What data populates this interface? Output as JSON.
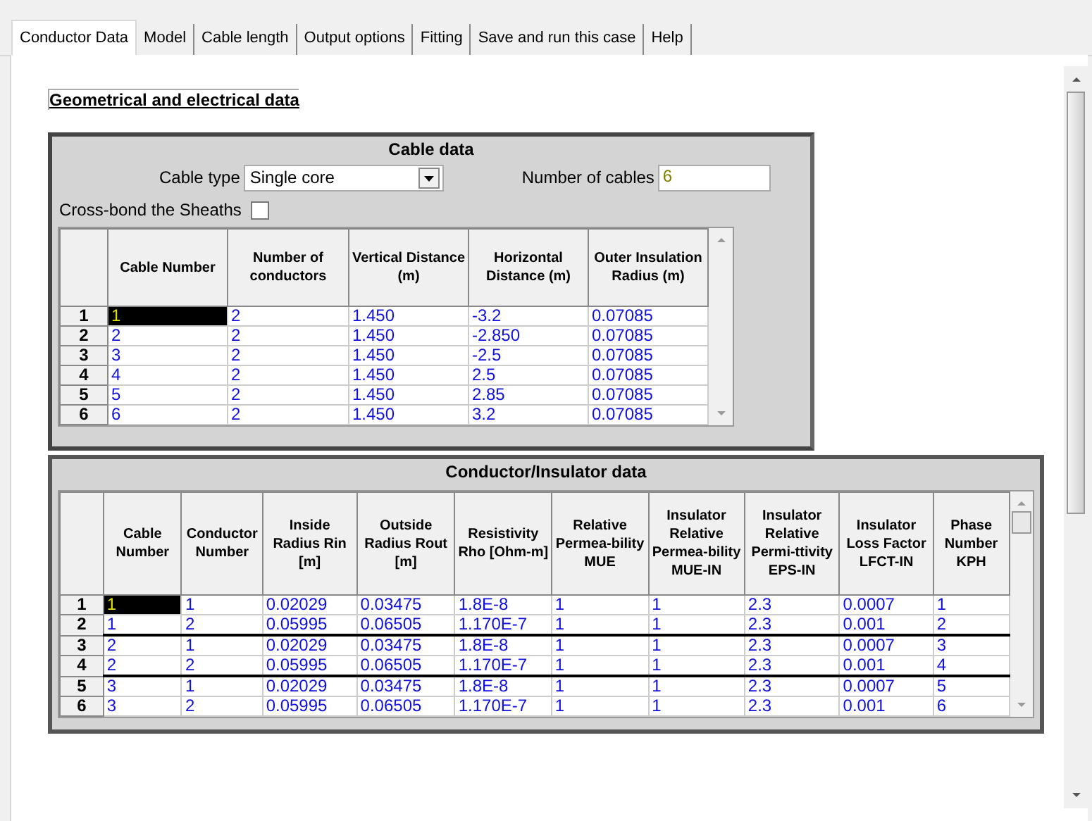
{
  "tabs": [
    {
      "label": "Conductor Data",
      "selected": true
    },
    {
      "label": "Model",
      "selected": false
    },
    {
      "label": "Cable length",
      "selected": false
    },
    {
      "label": "Output options",
      "selected": false
    },
    {
      "label": "Fitting",
      "selected": false
    },
    {
      "label": "Save and run this case",
      "selected": false
    },
    {
      "label": "Help",
      "selected": false
    }
  ],
  "heading": "Geometrical and electrical data",
  "cable_data": {
    "title": "Cable data",
    "cable_type_label": "Cable type",
    "cable_type": "Single core",
    "num_cables_label": "Number of cables",
    "num_cables": "6",
    "cross_bond_label": "Cross-bond the Sheaths",
    "cross_bond": false,
    "columns": [
      "Cable Number",
      "Number of conductors",
      "Vertical Distance (m)",
      "Horizontal Distance (m)",
      "Outer Insulation Radius (m)"
    ],
    "rows": [
      {
        "header": "1",
        "selected": true,
        "cells": [
          "1",
          "2",
          "1.450",
          "-3.2",
          "0.07085"
        ]
      },
      {
        "header": "2",
        "selected": false,
        "cells": [
          "2",
          "2",
          "1.450",
          "-2.850",
          "0.07085"
        ]
      },
      {
        "header": "3",
        "selected": false,
        "cells": [
          "3",
          "2",
          "1.450",
          "-2.5",
          "0.07085"
        ]
      },
      {
        "header": "4",
        "selected": false,
        "cells": [
          "4",
          "2",
          "1.450",
          "2.5",
          "0.07085"
        ]
      },
      {
        "header": "5",
        "selected": false,
        "cells": [
          "5",
          "2",
          "1.450",
          "2.85",
          "0.07085"
        ]
      },
      {
        "header": "6",
        "selected": false,
        "cells": [
          "6",
          "2",
          "1.450",
          "3.2",
          "0.07085"
        ]
      }
    ]
  },
  "conductor_data": {
    "title": "Conductor/Insulator data",
    "columns": [
      "Cable Number",
      "Conductor Number",
      "Inside Radius Rin [m]",
      "Outside Radius Rout [m]",
      "Resistivity Rho [Ohm-m]",
      "Relative Permea-bility MUE",
      "Insulator Relative Permea-bility MUE-IN",
      "Insulator Relative Permi-ttivity EPS-IN",
      "Insulator Loss Factor LFCT-IN",
      "Phase Number KPH"
    ],
    "rows": [
      {
        "header": "1",
        "selected": true,
        "group_end": false,
        "cells": [
          "1",
          "1",
          "0.02029",
          "0.03475",
          "1.8E-8",
          "1",
          "1",
          "2.3",
          "0.0007",
          "1"
        ]
      },
      {
        "header": "2",
        "selected": false,
        "group_end": true,
        "cells": [
          "1",
          "2",
          "0.05995",
          "0.06505",
          "1.170E-7",
          "1",
          "1",
          "2.3",
          "0.001",
          "2"
        ]
      },
      {
        "header": "3",
        "selected": false,
        "group_end": false,
        "cells": [
          "2",
          "1",
          "0.02029",
          "0.03475",
          "1.8E-8",
          "1",
          "1",
          "2.3",
          "0.0007",
          "3"
        ]
      },
      {
        "header": "4",
        "selected": false,
        "group_end": true,
        "cells": [
          "2",
          "2",
          "0.05995",
          "0.06505",
          "1.170E-7",
          "1",
          "1",
          "2.3",
          "0.001",
          "4"
        ]
      },
      {
        "header": "5",
        "selected": false,
        "group_end": false,
        "cells": [
          "3",
          "1",
          "0.02029",
          "0.03475",
          "1.8E-8",
          "1",
          "1",
          "2.3",
          "0.0007",
          "5"
        ]
      },
      {
        "header": "6",
        "selected": false,
        "group_end": false,
        "cells": [
          "3",
          "2",
          "0.05995",
          "0.06505",
          "1.170E-7",
          "1",
          "1",
          "2.3",
          "0.001",
          "6"
        ]
      }
    ]
  }
}
